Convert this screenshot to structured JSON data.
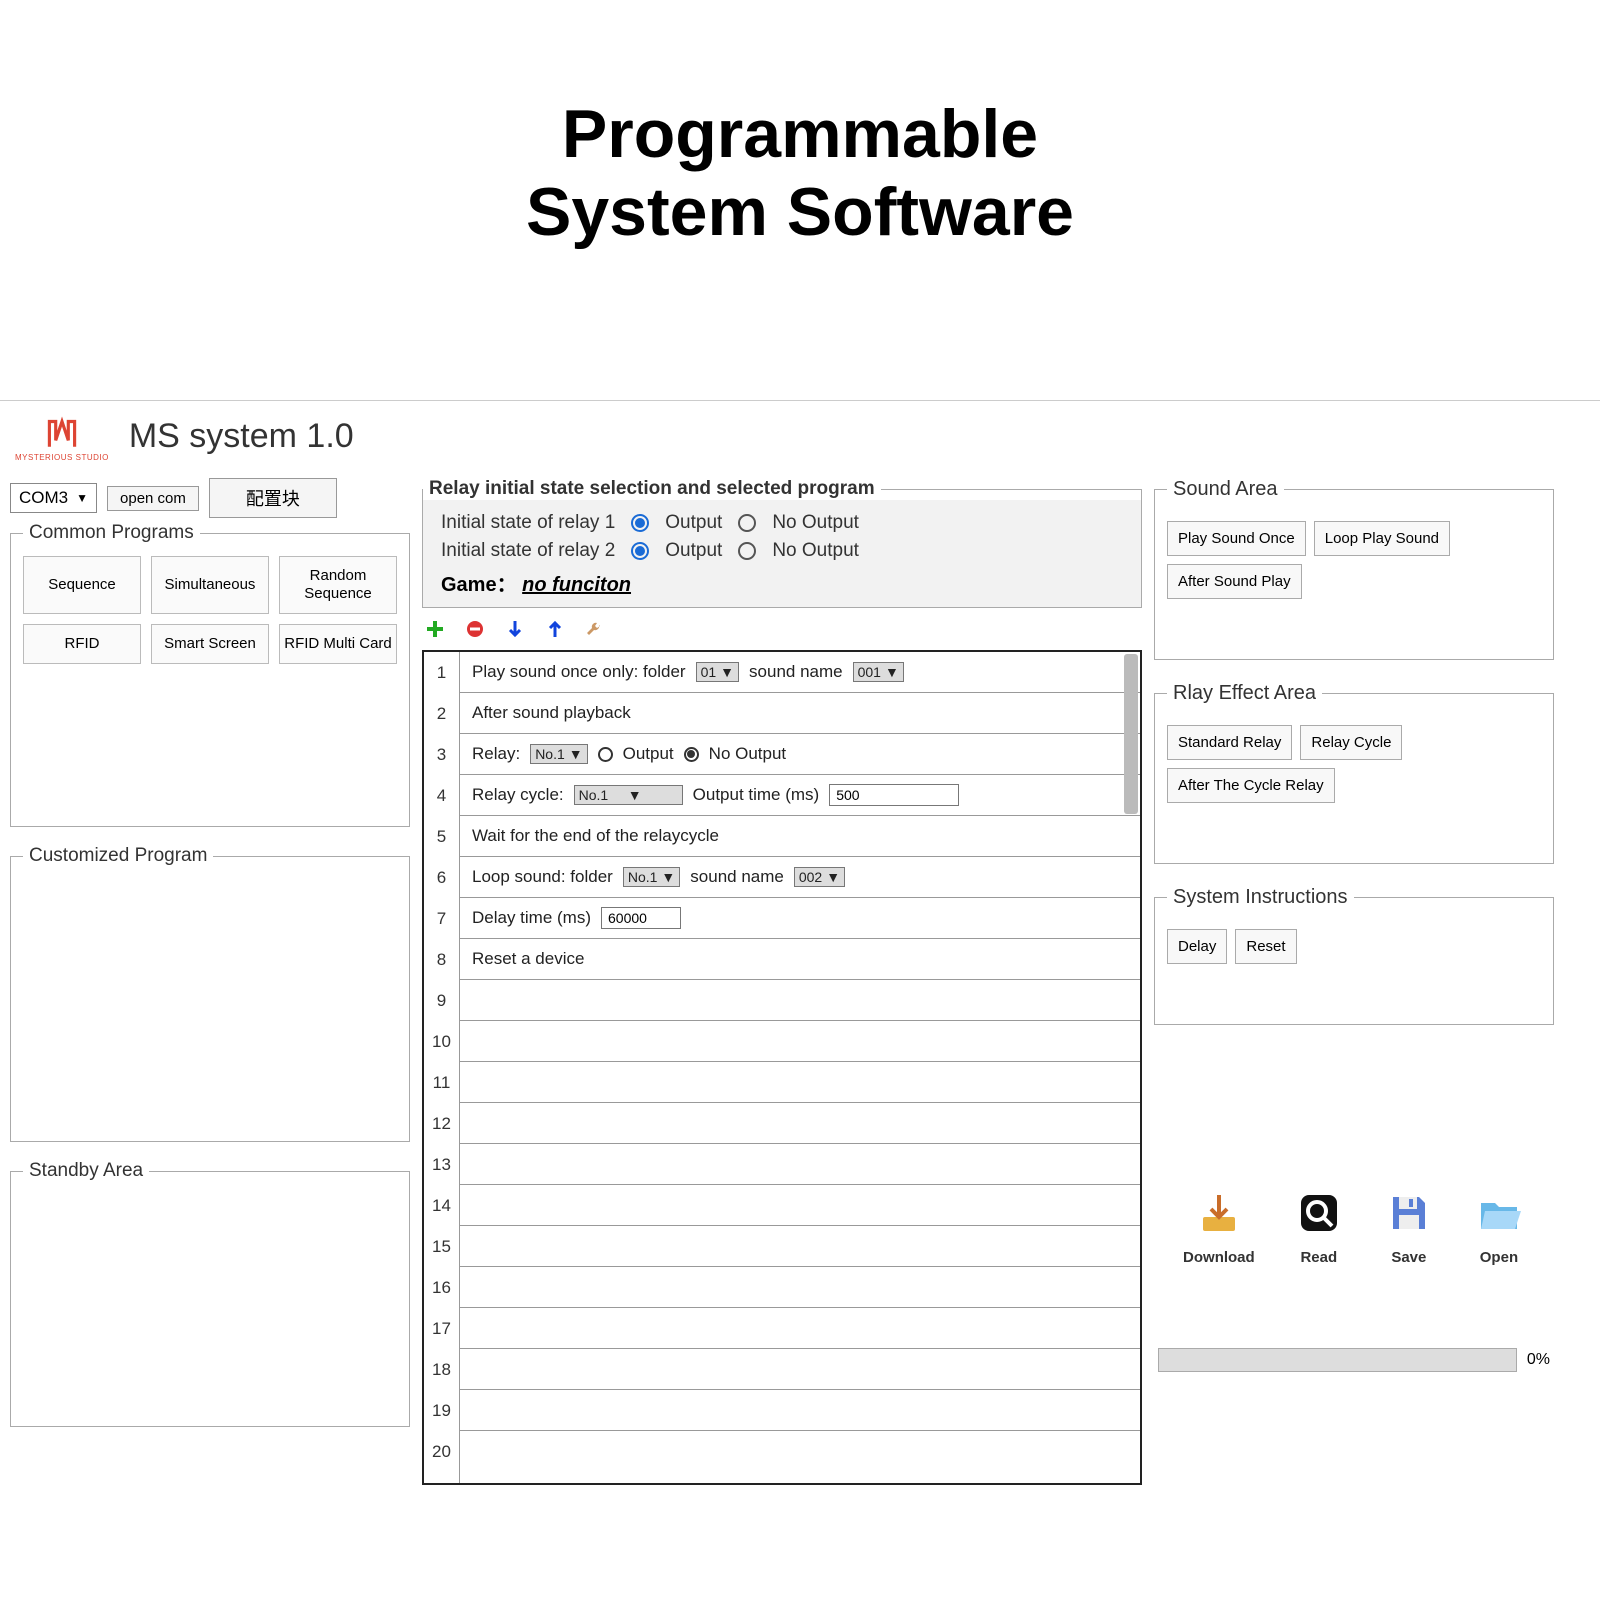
{
  "page_title_line1": "Programmable",
  "page_title_line2": "System Software",
  "app_title": "MS system 1.0",
  "logo_text": "MYSTERIOUS STUDIO",
  "com_port": "COM3",
  "btn_open_com": "open com",
  "btn_config": "配置块",
  "common_programs": {
    "legend": "Common Programs",
    "items": [
      "Sequence",
      "Simultaneous",
      "Random Sequence",
      "RFID",
      "Smart Screen",
      "RFID Multi Card"
    ]
  },
  "customized_program_legend": "Customized Program",
  "standby_area_legend": "Standby Area",
  "relay_panel": {
    "legend": "Relay initial state selection and selected program",
    "row1_label": "Initial state of relay 1",
    "row2_label": "Initial state of relay 2",
    "output": "Output",
    "no_output": "No Output",
    "game_label": "Game：",
    "game_value": "no funciton"
  },
  "steps": {
    "r1_a": "Play sound once only: folder",
    "r1_folder": "01",
    "r1_b": "sound name",
    "r1_sound": "001",
    "r2": "After sound playback",
    "r3_a": "Relay:",
    "r3_relay": "No.1",
    "r3_output": "Output",
    "r3_nooutput": "No Output",
    "r4_a": "Relay cycle:",
    "r4_relay": "No.1",
    "r4_b": "Output time (ms)",
    "r4_val": "500",
    "r5": "Wait for the end of the relaycycle",
    "r6_a": "Loop sound: folder",
    "r6_folder": "No.1",
    "r6_b": "sound name",
    "r6_sound": "002",
    "r7_a": "Delay time (ms)",
    "r7_val": "60000",
    "r8": "Reset a device"
  },
  "sound_area": {
    "legend": "Sound Area",
    "buttons": [
      "Play Sound Once",
      "Loop Play Sound",
      "After Sound Play"
    ]
  },
  "relay_effect": {
    "legend": "Rlay Effect Area",
    "buttons": [
      "Standard Relay",
      "Relay Cycle",
      "After The Cycle Relay"
    ]
  },
  "system_instructions": {
    "legend": "System Instructions",
    "buttons": [
      "Delay",
      "Reset"
    ]
  },
  "actions": {
    "download": "Download",
    "read": "Read",
    "save": "Save",
    "open": "Open"
  },
  "progress": "0%"
}
